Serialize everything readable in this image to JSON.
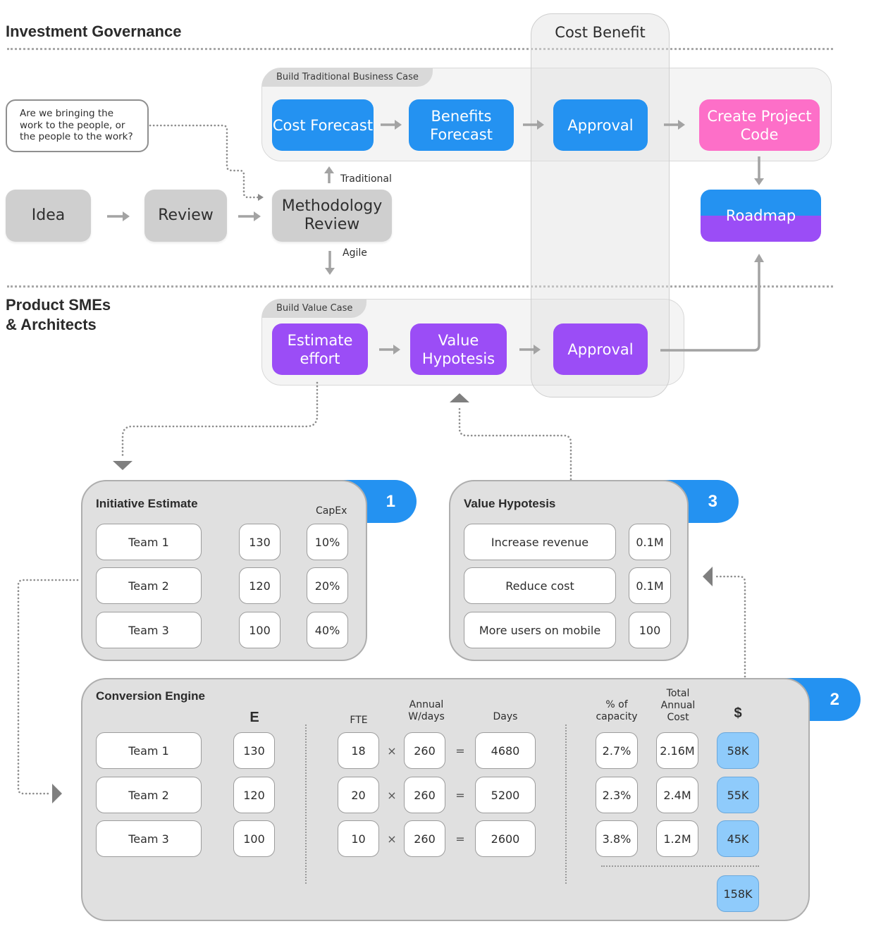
{
  "sections": {
    "investment_governance": "Investment Governance",
    "product_smes_line1": "Product SMEs",
    "product_smes_line2": "& Architects"
  },
  "cost_benefit": {
    "label": "Cost Benefit"
  },
  "question_note": "Are we bringing the work to the people, or the people to the work?",
  "intake_flow": {
    "idea": "Idea",
    "review": "Review",
    "methodology_review": "Methodology Review",
    "traditional_label": "Traditional",
    "agile_label": "Agile"
  },
  "traditional_case": {
    "tab": "Build Traditional Business Case",
    "steps": [
      "Cost Forecast",
      "Benefits Forecast",
      "Approval",
      "Create Project Code"
    ]
  },
  "roadmap": "Roadmap",
  "value_case": {
    "tab": "Build Value Case",
    "steps": [
      "Estimate effort",
      "Value Hypotesis",
      "Approval"
    ]
  },
  "initiative_estimate": {
    "title": "Initiative Estimate",
    "badge": "1",
    "capex_header": "CapEx",
    "rows": [
      {
        "team": "Team 1",
        "estimate": "130",
        "capex": "10%"
      },
      {
        "team": "Team 2",
        "estimate": "120",
        "capex": "20%"
      },
      {
        "team": "Team 3",
        "estimate": "100",
        "capex": "40%"
      }
    ]
  },
  "value_hypothesis": {
    "title": "Value Hypotesis",
    "badge": "3",
    "rows": [
      {
        "label": "Increase revenue",
        "value": "0.1M"
      },
      {
        "label": "Reduce cost",
        "value": "0.1M"
      },
      {
        "label": "More users on mobile",
        "value": "100"
      }
    ]
  },
  "conversion_engine": {
    "title": "Conversion Engine",
    "badge": "2",
    "headers": {
      "estimate": "E",
      "fte": "FTE",
      "annual_wdays": "Annual W/days",
      "days": "Days",
      "pct_capacity": "% of capacity",
      "total_annual_cost": "Total Annual Cost",
      "dollars": "$"
    },
    "multiply_symbol": "×",
    "equals_symbol": "=",
    "rows": [
      {
        "team": "Team 1",
        "estimate": "130",
        "fte": "18",
        "wdays": "260",
        "days": "4680",
        "pct": "2.7%",
        "cost": "2.16M",
        "dollars": "58K"
      },
      {
        "team": "Team 2",
        "estimate": "120",
        "fte": "20",
        "wdays": "260",
        "days": "5200",
        "pct": "2.3%",
        "cost": "2.4M",
        "dollars": "55K"
      },
      {
        "team": "Team 3",
        "estimate": "100",
        "fte": "10",
        "wdays": "260",
        "days": "2600",
        "pct": "3.8%",
        "cost": "1.2M",
        "dollars": "45K"
      }
    ],
    "total": "158K"
  },
  "colors": {
    "blue": "#2492f1",
    "pink": "#fd6fc8",
    "purple": "#9b4df6",
    "grey_node": "#cfcfcf",
    "money_cell": "#8fcbfb"
  }
}
